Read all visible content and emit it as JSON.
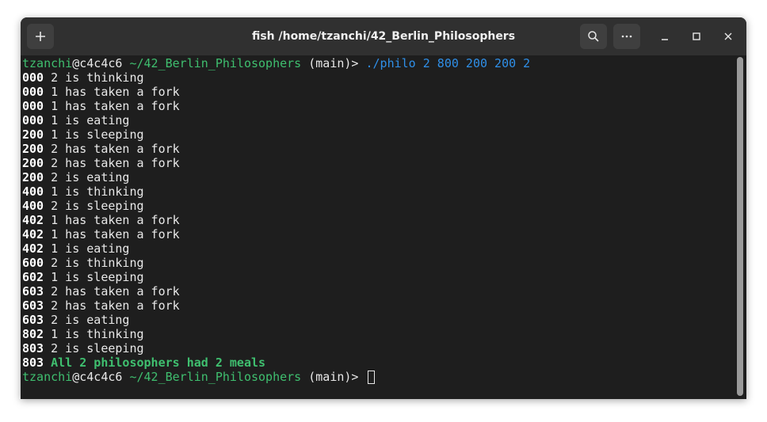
{
  "window": {
    "title": "fish /home/tzanchi/42_Berlin_Philosophers"
  },
  "toolbar": {
    "new_tab_icon": "plus-icon",
    "search_icon": "search-icon",
    "menu_icon": "ellipsis-icon",
    "minimize_icon": "minimize-icon",
    "maximize_icon": "maximize-icon",
    "close_icon": "close-icon"
  },
  "prompt": {
    "user": "tzanchi",
    "at_host": "@c4c4c6",
    "cwd": " ~/42_Berlin_Philosophers",
    "branch": " (main)> ",
    "command": "./philo 2 800 200 200 2"
  },
  "output": [
    {
      "ts": "000",
      "msg": " 2 is thinking"
    },
    {
      "ts": "000",
      "msg": " 1 has taken a fork"
    },
    {
      "ts": "000",
      "msg": " 1 has taken a fork"
    },
    {
      "ts": "000",
      "msg": " 1 is eating"
    },
    {
      "ts": "200",
      "msg": " 1 is sleeping"
    },
    {
      "ts": "200",
      "msg": " 2 has taken a fork"
    },
    {
      "ts": "200",
      "msg": " 2 has taken a fork"
    },
    {
      "ts": "200",
      "msg": " 2 is eating"
    },
    {
      "ts": "400",
      "msg": " 1 is thinking"
    },
    {
      "ts": "400",
      "msg": " 2 is sleeping"
    },
    {
      "ts": "402",
      "msg": " 1 has taken a fork"
    },
    {
      "ts": "402",
      "msg": " 1 has taken a fork"
    },
    {
      "ts": "402",
      "msg": " 1 is eating"
    },
    {
      "ts": "600",
      "msg": " 2 is thinking"
    },
    {
      "ts": "602",
      "msg": " 1 is sleeping"
    },
    {
      "ts": "603",
      "msg": " 2 has taken a fork"
    },
    {
      "ts": "603",
      "msg": " 2 has taken a fork"
    },
    {
      "ts": "603",
      "msg": " 2 is eating"
    },
    {
      "ts": "802",
      "msg": " 1 is thinking"
    },
    {
      "ts": "803",
      "msg": " 2 is sleeping"
    }
  ],
  "final": {
    "ts": "803",
    "msg": " All 2 philosophers had 2 meals"
  },
  "colors": {
    "prompt_green": "#3fbf6f",
    "command_blue": "#2f8fe8",
    "background": "#1e1e1e"
  }
}
